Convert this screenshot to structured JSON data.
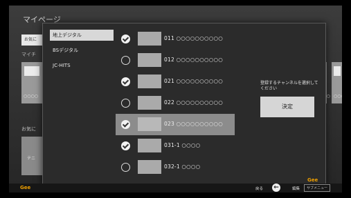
{
  "background": {
    "title": "マイページ",
    "tab_label": "お気に",
    "section1": "マイチ",
    "section2": "お気に",
    "card1_text": "○○○○",
    "card2_text": "○○○",
    "card3_text": "○○○",
    "box2_text": "テニ"
  },
  "menu": {
    "items": [
      {
        "label": "地上デジタル",
        "selected": true
      },
      {
        "label": "BSデジタル",
        "selected": false
      },
      {
        "label": "JC-HITS",
        "selected": false
      }
    ]
  },
  "channels": [
    {
      "label": "011 ○○○○○○○○○○",
      "checked": true,
      "highlighted": false
    },
    {
      "label": "012 ○○○○○○○○○○",
      "checked": false,
      "highlighted": false
    },
    {
      "label": "021 ○○○○○○○○○○",
      "checked": true,
      "highlighted": false
    },
    {
      "label": "022 ○○○○○○○○○○",
      "checked": false,
      "highlighted": false
    },
    {
      "label": "023 ○○○○○○○○○○",
      "checked": true,
      "highlighted": true
    },
    {
      "label": "031-1 ○○○○",
      "checked": true,
      "highlighted": false
    },
    {
      "label": "032-1 ○○○○",
      "checked": false,
      "highlighted": false
    }
  ],
  "panel": {
    "instruction": "登録するチャンネルを選択してください",
    "ok_label": "決定",
    "logo": "Gee"
  },
  "footer": {
    "logo": "Gee",
    "back_label": "戻る",
    "edit_label": "編集",
    "submenu_label": "サブメニュー"
  },
  "colors": {
    "accent": "#f0a000",
    "selected_menu_bg": "#d8d8d8",
    "highlight_row_bg": "#8c8c8c"
  }
}
